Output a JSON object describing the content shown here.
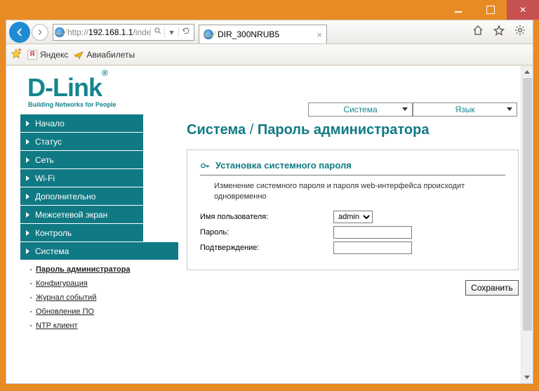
{
  "browser": {
    "url_scheme": "http://",
    "url_host": "192.168.1.1",
    "url_path": "/index",
    "tab_title": "DIR_300NRUB5",
    "fav_yandex": "Яндекс",
    "fav_avia": "Авиабилеты",
    "ya_letter": "Я"
  },
  "logo": {
    "brand_d": "D",
    "brand_dash": "-",
    "brand_link": "Link",
    "slogan": "Building Networks for People"
  },
  "topdrops": {
    "system": "Система",
    "lang": "Язык"
  },
  "nav": {
    "i0": "Начало",
    "i1": "Статус",
    "i2": "Сеть",
    "i3": "Wi-Fi",
    "i4": "Дополнительно",
    "i5": "Межсетевой экран",
    "i6": "Контроль",
    "i7": "Система"
  },
  "subnav": {
    "s0": "Пароль администратора",
    "s1": "Конфигурация",
    "s2": "Журнал событий",
    "s3": "Обновление ПО",
    "s4": "NTP клиент"
  },
  "content": {
    "crumb_sec": "Система",
    "crumb_sep": " / ",
    "crumb_page": "Пароль администратора",
    "panel_title": "Установка системного пароля",
    "panel_desc": "Изменение системного пароля и пароля web-интерфейса происходит одновременно",
    "lbl_user": "Имя пользователя:",
    "lbl_pass": "Пароль:",
    "lbl_conf": "Подтверждение:",
    "val_user": "admin",
    "val_pass": "",
    "val_conf": "",
    "save": "Сохранить"
  }
}
